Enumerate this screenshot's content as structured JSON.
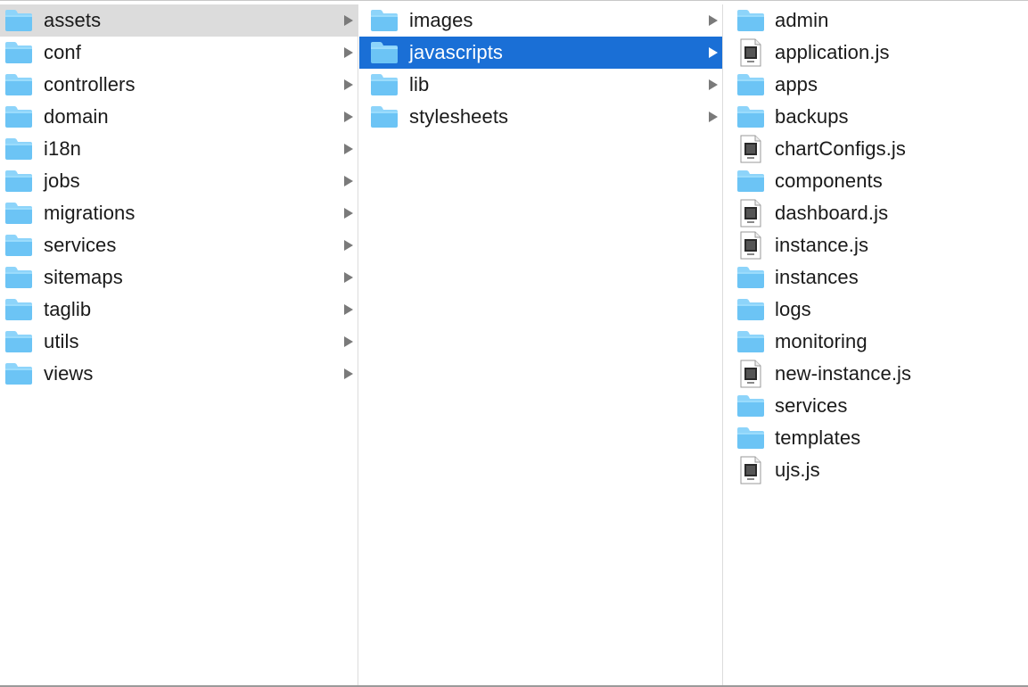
{
  "columns": [
    {
      "items": [
        {
          "name": "assets",
          "type": "folder",
          "selected": "inactive"
        },
        {
          "name": "conf",
          "type": "folder"
        },
        {
          "name": "controllers",
          "type": "folder"
        },
        {
          "name": "domain",
          "type": "folder"
        },
        {
          "name": "i18n",
          "type": "folder"
        },
        {
          "name": "jobs",
          "type": "folder"
        },
        {
          "name": "migrations",
          "type": "folder"
        },
        {
          "name": "services",
          "type": "folder"
        },
        {
          "name": "sitemaps",
          "type": "folder"
        },
        {
          "name": "taglib",
          "type": "folder"
        },
        {
          "name": "utils",
          "type": "folder"
        },
        {
          "name": "views",
          "type": "folder"
        }
      ]
    },
    {
      "items": [
        {
          "name": "images",
          "type": "folder"
        },
        {
          "name": "javascripts",
          "type": "folder",
          "selected": "active"
        },
        {
          "name": "lib",
          "type": "folder"
        },
        {
          "name": "stylesheets",
          "type": "folder"
        }
      ]
    },
    {
      "items": [
        {
          "name": "admin",
          "type": "folder"
        },
        {
          "name": "application.js",
          "type": "file"
        },
        {
          "name": "apps",
          "type": "folder"
        },
        {
          "name": "backups",
          "type": "folder"
        },
        {
          "name": "chartConfigs.js",
          "type": "file"
        },
        {
          "name": "components",
          "type": "folder"
        },
        {
          "name": "dashboard.js",
          "type": "file"
        },
        {
          "name": "instance.js",
          "type": "file"
        },
        {
          "name": "instances",
          "type": "folder"
        },
        {
          "name": "logs",
          "type": "folder"
        },
        {
          "name": "monitoring",
          "type": "folder"
        },
        {
          "name": "new-instance.js",
          "type": "file"
        },
        {
          "name": "services",
          "type": "folder"
        },
        {
          "name": "templates",
          "type": "folder"
        },
        {
          "name": "ujs.js",
          "type": "file"
        }
      ]
    }
  ],
  "colors": {
    "folder_body": "#6cc4f5",
    "folder_top": "#8dd4fa",
    "selection_active": "#1a6fd6",
    "selection_inactive": "#dcdcdc"
  }
}
